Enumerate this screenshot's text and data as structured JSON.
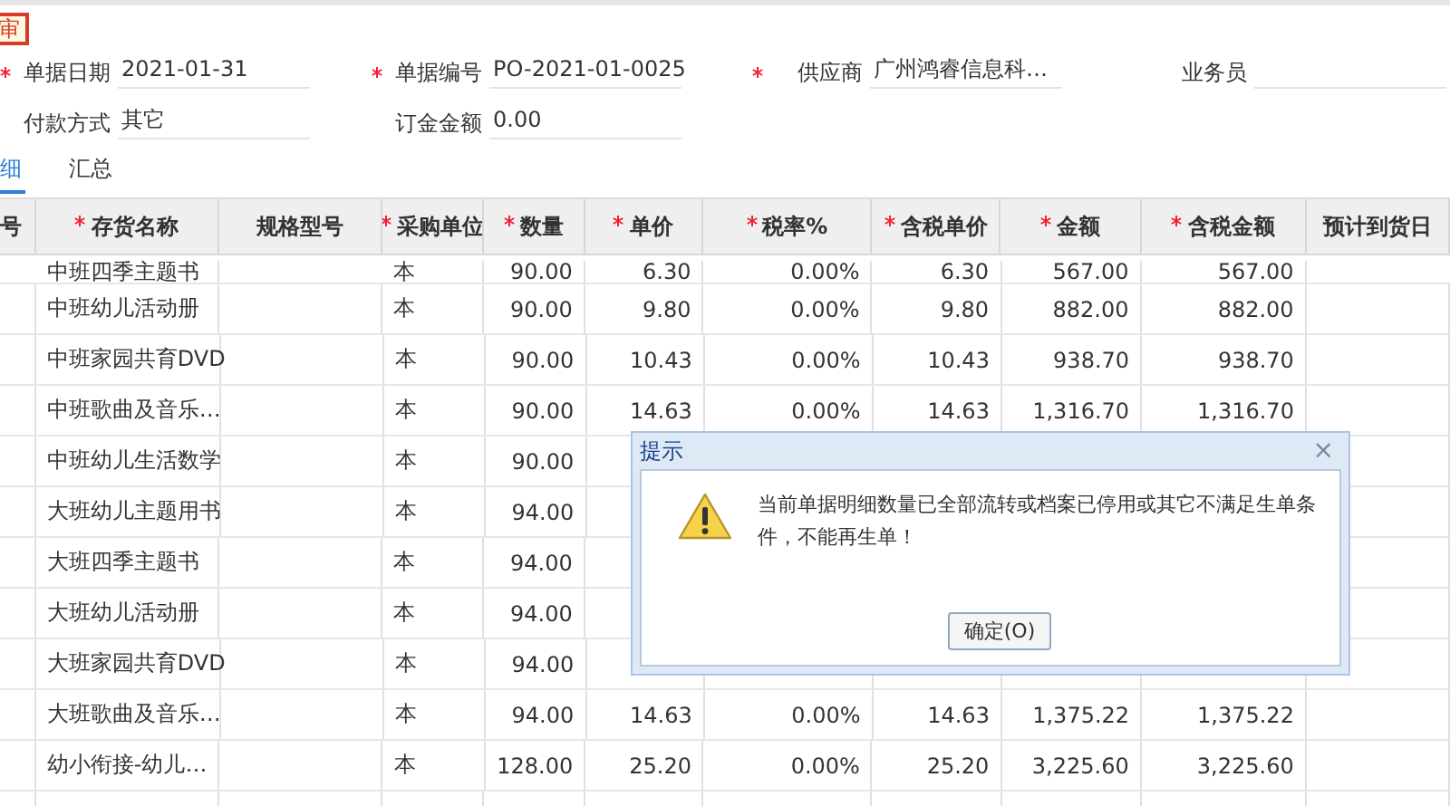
{
  "stamp": "审",
  "form": [
    {
      "label": "单据日期",
      "required": true,
      "value": "2021-01-31"
    },
    {
      "label": "单据编号",
      "required": true,
      "value": "PO-2021-01-0025"
    },
    {
      "label": "供应商",
      "required": true,
      "value": "广州鸿睿信息科…"
    },
    {
      "label": "业务员"
    },
    {
      "label": "付款方式",
      "value": "其它"
    },
    {
      "label": "订金金额",
      "value": "0.00"
    }
  ],
  "tabs": [
    {
      "label": "细",
      "selected": true
    },
    {
      "label": "汇总",
      "selected": false
    }
  ],
  "table": {
    "columns": [
      {
        "label": "号"
      },
      {
        "label": "存货名称",
        "required": true,
        "kind": "text"
      },
      {
        "label": "规格型号"
      },
      {
        "label": "采购单位",
        "required": true,
        "kind": "text"
      },
      {
        "label": "数量",
        "required": true,
        "kind": "number"
      },
      {
        "label": "单价",
        "required": true,
        "kind": "number"
      },
      {
        "label": "税率%",
        "required": true,
        "kind": "number"
      },
      {
        "label": "含税单价",
        "required": true,
        "kind": "number"
      },
      {
        "label": "金额",
        "required": true,
        "kind": "number"
      },
      {
        "label": "含税金额",
        "required": true,
        "kind": "number"
      },
      {
        "label": "预计到货日"
      }
    ],
    "rows": [
      {
        "cells": {
          "1": "中班四季主题书",
          "3": "本",
          "4": "90.00",
          "5": "6.30",
          "6": "0.00%",
          "7": "6.30",
          "8": "567.00",
          "9": "567.00"
        }
      },
      {
        "cells": {
          "1": "中班幼儿活动册",
          "3": "本",
          "4": "90.00",
          "5": "9.80",
          "6": "0.00%",
          "7": "9.80",
          "8": "882.00",
          "9": "882.00"
        }
      },
      {
        "cells": {
          "1": "中班家园共育DVD",
          "3": "本",
          "4": "90.00",
          "5": "10.43",
          "6": "0.00%",
          "7": "10.43",
          "8": "938.70",
          "9": "938.70"
        }
      },
      {
        "cells": {
          "1": "中班歌曲及音乐…",
          "3": "本",
          "4": "90.00",
          "5": "14.63",
          "6": "0.00%",
          "7": "14.63",
          "8": "1,316.70",
          "9": "1,316.70"
        }
      },
      {
        "cells": {
          "1": "中班幼儿生活数学",
          "3": "本",
          "4": "90.00"
        }
      },
      {
        "cells": {
          "1": "大班幼儿主题用书",
          "3": "本",
          "4": "94.00"
        }
      },
      {
        "cells": {
          "1": "大班四季主题书",
          "3": "本",
          "4": "94.00"
        }
      },
      {
        "cells": {
          "1": "大班幼儿活动册",
          "3": "本",
          "4": "94.00"
        }
      },
      {
        "cells": {
          "1": "大班家园共育DVD",
          "3": "本",
          "4": "94.00"
        }
      },
      {
        "cells": {
          "1": "大班歌曲及音乐…",
          "3": "本",
          "4": "94.00",
          "5": "14.63",
          "6": "0.00%",
          "7": "14.63",
          "8": "1,375.22",
          "9": "1,375.22"
        }
      },
      {
        "cells": {
          "1": "幼小衔接-幼儿…",
          "3": "本",
          "4": "128.00",
          "5": "25.20",
          "6": "0.00%",
          "7": "25.20",
          "8": "3,225.60",
          "9": "3,225.60"
        }
      },
      {
        "cells": {}
      }
    ]
  },
  "dialog": {
    "title": "提示",
    "close": "×",
    "message": "当前单据明细数量已全部流转或档案已停用或其它不满足生单条件，不能再生单！",
    "button": "确定(O)"
  }
}
